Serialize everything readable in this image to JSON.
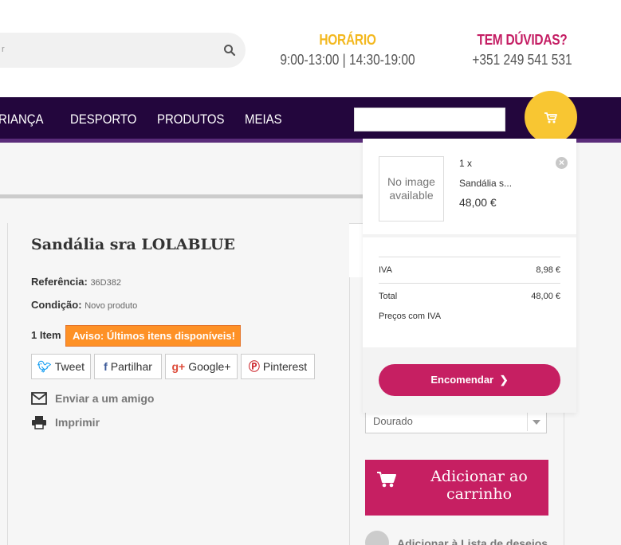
{
  "header": {
    "hours": {
      "title": "HORÁRIO",
      "value": "9:00-13:00 | 14:30-19:00"
    },
    "help": {
      "title": "TEM DÚVIDAS?",
      "value": "+351 249 541 531"
    }
  },
  "nav": {
    "items": [
      "RIANÇA",
      "DESPORTO",
      "PRODUTOS",
      "MEIAS"
    ]
  },
  "product": {
    "title": "Sandália sra LOLABLUE",
    "reference_label": "Referência:",
    "reference_value": "36D382",
    "condition_label": "Condição:",
    "condition_value": "Novo produto",
    "stock": "1 Item",
    "warning": "Aviso: Últimos itens disponíveis!",
    "share": {
      "tweet": "Tweet",
      "facebook": "Partilhar",
      "google": "Google+",
      "pinterest": "Pinterest"
    },
    "send_to_friend": "Enviar a um amigo",
    "print": "Imprimir"
  },
  "options": {
    "color_selected": "Dourado",
    "add_to_cart": "Adicionar ao carrinho",
    "wishlist": "Adicionar à Lista de desejos"
  },
  "cart_dropdown": {
    "item": {
      "image_placeholder": "No image available",
      "quantity": "1 x",
      "name": "Sandália s...",
      "price": "48,00 €"
    },
    "tax_label": "IVA",
    "tax_value": "8,98 €",
    "total_label": "Total",
    "total_value": "48,00 €",
    "tax_note": "Preços com IVA",
    "checkout": "Encomendar"
  },
  "colors": {
    "nav_bg": "#23063d",
    "accent_yellow": "#f3b81f",
    "accent_pink": "#c61f62",
    "warning_orange": "#fe9126"
  }
}
